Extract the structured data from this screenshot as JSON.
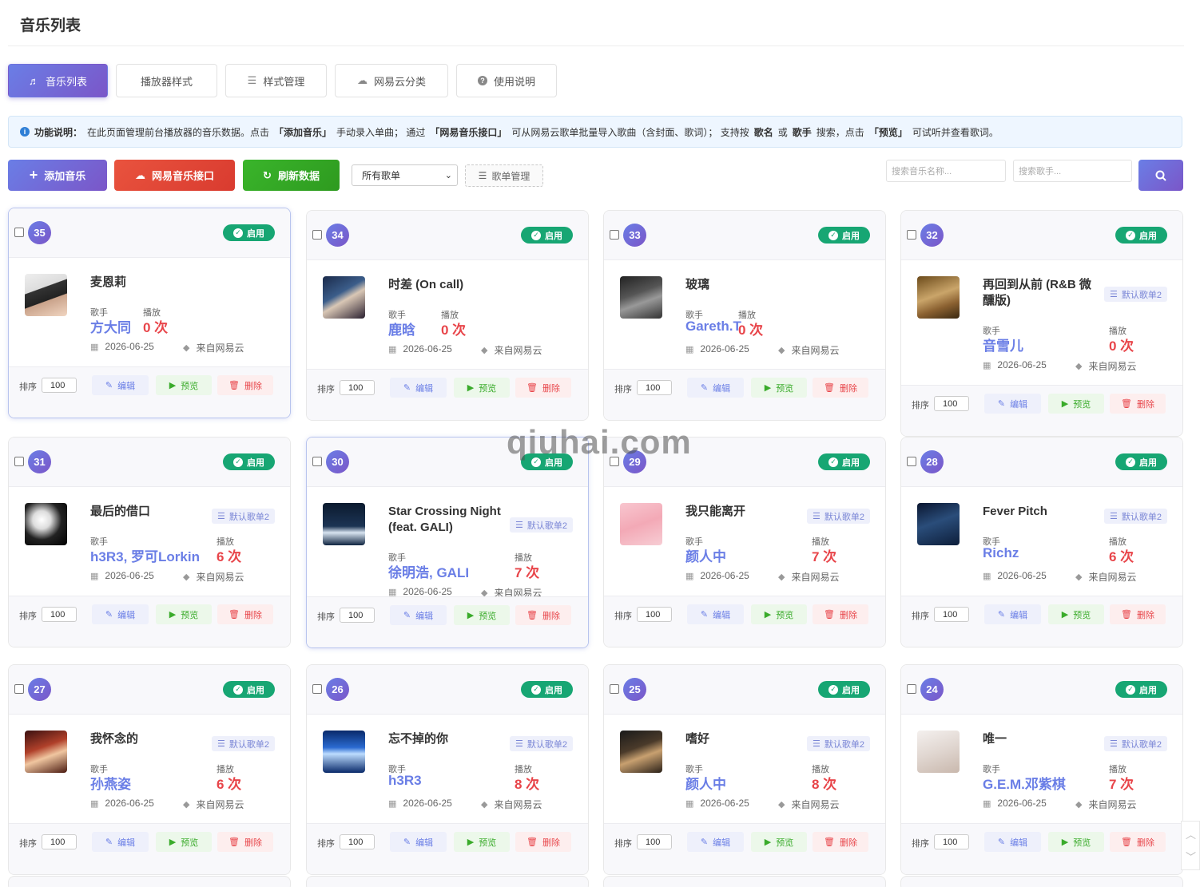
{
  "page": {
    "title": "音乐列表"
  },
  "tabs": [
    {
      "label": "音乐列表",
      "icon": "music-note-icon",
      "active": true
    },
    {
      "label": "播放器样式",
      "icon": "",
      "active": false
    },
    {
      "label": "样式管理",
      "icon": "list-icon",
      "active": false
    },
    {
      "label": "网易云分类",
      "icon": "cloud-icon",
      "active": false
    },
    {
      "label": "使用说明",
      "icon": "help-icon",
      "active": false
    }
  ],
  "notice": {
    "label": "功能说明：",
    "text1": "在此页面管理前台播放器的音乐数据。点击",
    "k1": "「添加音乐」",
    "text2": "手动录入单曲；  通过",
    "k2": "「网易音乐接口」",
    "text3": "可从网易云歌单批量导入歌曲（含封面、歌词）；  支持按",
    "k3": "歌名",
    "text4": "或",
    "k4": "歌手",
    "text5": "搜索，点击",
    "k5": "「预览」",
    "text6": "可试听并查看歌词。"
  },
  "toolbar": {
    "add_label": "添加音乐",
    "api_label": "网易音乐接口",
    "refresh_label": "刷新数据",
    "playlist_select": "所有歌单",
    "playlist_manage": "歌单管理",
    "search_name_placeholder": "搜索音乐名称...",
    "search_singer_placeholder": "搜索歌手..."
  },
  "labels": {
    "status": "启用",
    "singer": "歌手",
    "plays": "播放",
    "sort": "排序",
    "edit": "编辑",
    "preview": "预览",
    "delete": "删除"
  },
  "songs": [
    {
      "id": "35",
      "title": "麦恩莉",
      "singer": "方大同",
      "plays": "0 次",
      "date": "2026-06-25",
      "source": "来自网易云",
      "tag": "",
      "sort": "100"
    },
    {
      "id": "34",
      "title": "时差 (On call)",
      "singer": "鹿晗",
      "plays": "0 次",
      "date": "2026-06-25",
      "source": "来自网易云",
      "tag": "",
      "sort": "100"
    },
    {
      "id": "33",
      "title": "玻璃",
      "singer": "Gareth.T",
      "plays": "0 次",
      "date": "2026-06-25",
      "source": "来自网易云",
      "tag": "",
      "sort": "100"
    },
    {
      "id": "32",
      "title": "再回到从前 (R&B 微醺版)",
      "singer": "音雪儿",
      "plays": "0 次",
      "date": "2026-06-25",
      "source": "来自网易云",
      "tag": "默认歌单2",
      "sort": "100"
    },
    {
      "id": "31",
      "title": "最后的借口",
      "singer": "h3R3, 罗可Lorkin",
      "plays": "6 次",
      "date": "2026-06-25",
      "source": "来自网易云",
      "tag": "默认歌单2",
      "sort": "100"
    },
    {
      "id": "30",
      "title": "Star Crossing Night (feat. GALI)",
      "singer": "徐明浩, GALI",
      "plays": "7 次",
      "date": "2026-06-25",
      "source": "来自网易云",
      "tag": "默认歌单2",
      "sort": "100"
    },
    {
      "id": "29",
      "title": "我只能离开",
      "singer": "颜人中",
      "plays": "7 次",
      "date": "2026-06-25",
      "source": "来自网易云",
      "tag": "默认歌单2",
      "sort": "100"
    },
    {
      "id": "28",
      "title": "Fever Pitch",
      "singer": "Richz",
      "plays": "6 次",
      "date": "2026-06-25",
      "source": "来自网易云",
      "tag": "默认歌单2",
      "sort": "100"
    },
    {
      "id": "27",
      "title": "我怀念的",
      "singer": "孙燕姿",
      "plays": "6 次",
      "date": "2026-06-25",
      "source": "来自网易云",
      "tag": "默认歌单2",
      "sort": "100"
    },
    {
      "id": "26",
      "title": "忘不掉的你",
      "singer": "h3R3",
      "plays": "8 次",
      "date": "2026-06-25",
      "source": "来自网易云",
      "tag": "默认歌单2",
      "sort": "100"
    },
    {
      "id": "25",
      "title": "嗜好",
      "singer": "颜人中",
      "plays": "8 次",
      "date": "2026-06-25",
      "source": "来自网易云",
      "tag": "默认歌单2",
      "sort": "100"
    },
    {
      "id": "24",
      "title": "唯一",
      "singer": "G.E.M.邓紫棋",
      "plays": "7 次",
      "date": "2026-06-25",
      "source": "来自网易云",
      "tag": "默认歌单2",
      "sort": "100"
    }
  ],
  "watermark": "qiuhai.com",
  "colors": {
    "accent": "#6a7ee6",
    "status_green": "#17a673",
    "danger": "#e8454a",
    "success": "#3aab2b"
  }
}
